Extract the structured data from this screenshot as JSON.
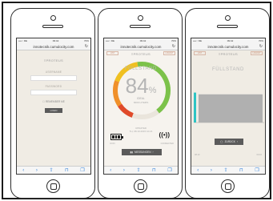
{
  "colors": {
    "screen_bg": "#f0ece4",
    "gauge_green": "#7cc24a",
    "gauge_yellow": "#f0c020",
    "gauge_orange": "#f0902a",
    "gauge_red": "#e04a2a",
    "bar_teal": "#2ec4c4",
    "bar_grey": "#b0b0b0",
    "button_dark": "#5a5a5a"
  },
  "browser": {
    "carrier": "••••○ DE",
    "time": "09:42",
    "battery": "70%",
    "url_phone1": "innotecnik.cumulocity.com",
    "url_phone2": "innotecnik.cumulocity.com",
    "url_phone3": "innotecnik.cumulocity.com",
    "reload_icon": "reload-icon",
    "toolbar_icons": [
      "back-icon",
      "forward-icon",
      "share-icon",
      "bookmarks-icon",
      "tabs-icon"
    ]
  },
  "login": {
    "brand": "≡PROTEUS",
    "username_label": "USERNAME",
    "password_label": "PASSWORD",
    "remember_label": "REMEMBER ME",
    "login_button": "LOGIN"
  },
  "dashboard": {
    "top_left": "LIST",
    "top_right": "LOGOUT",
    "brand": "≡PROTEUS",
    "title": "FÜLLSTAND",
    "percent_value": "84",
    "percent_unit": "%",
    "ideal": "IDEAL",
    "liters": "3000 LITERS",
    "updated_line1": "UPDATED",
    "updated_line2": "TH, 08.10.2015 10:21",
    "level_fraction": 0.84,
    "battery_label": "ICON",
    "signal_label": "CONNECTED",
    "measure_button": "MESSUNGEN"
  },
  "history": {
    "top_left": "LIST",
    "top_right": "LOGOUT",
    "brand": "≡PROTEUS",
    "title": "FÜLLSTAND",
    "back_button": "ZURÜCK",
    "foot_left": "08.10",
    "foot_right": "09.10"
  },
  "chart_data": {
    "type": "bar",
    "categories": [
      "1",
      "2"
    ],
    "series": [
      {
        "values": [
          85,
          80
        ]
      }
    ],
    "ylim": [
      0,
      100
    ],
    "title": "",
    "xlabel": "",
    "ylabel": ""
  }
}
